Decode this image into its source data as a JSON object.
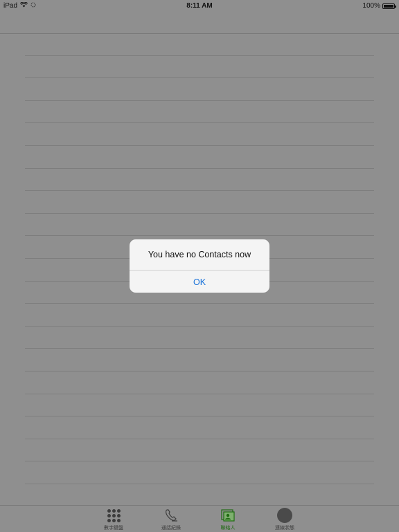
{
  "status_bar": {
    "device": "iPad",
    "time": "8:11 AM",
    "battery_text": "100%",
    "battery_level": 1.0
  },
  "alert": {
    "message": "You have no Contacts now",
    "ok_label": "OK",
    "accent_color": "#1a73d9"
  },
  "tabs": [
    {
      "label": "數字鍵盤",
      "icon": "keypad-icon",
      "active": false
    },
    {
      "label": "通話紀錄",
      "icon": "phone-icon",
      "active": false
    },
    {
      "label": "聯絡人",
      "icon": "contacts-icon",
      "active": true
    },
    {
      "label": "連線狀態",
      "icon": "status-circle-icon",
      "active": false
    }
  ],
  "colors": {
    "dim_background": "#8f8f8f",
    "active_tab": "#1f6b12"
  }
}
